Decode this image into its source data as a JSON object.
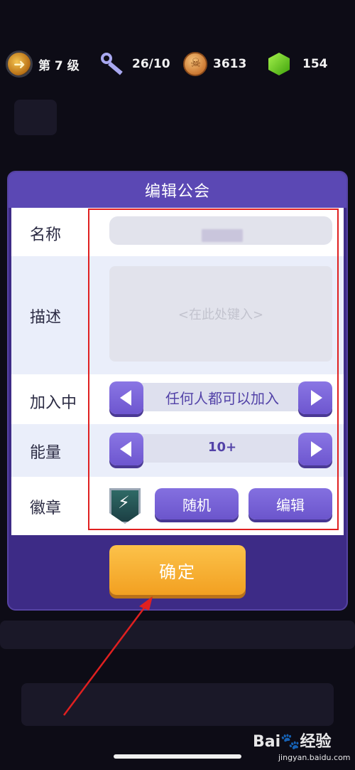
{
  "status_bar": {
    "level": "第 7 级",
    "keys": "26/10",
    "coins": "3613",
    "gems": "154",
    "icons": [
      "level-badge-icon",
      "key-icon",
      "skull-coin-icon",
      "green-gem-icon"
    ]
  },
  "dialog": {
    "title": "编辑公会",
    "name_label": "名称",
    "description_label": "描述",
    "description_placeholder": "<在此处键入>",
    "join_label": "加入中",
    "join_value": "任何人都可以加入",
    "energy_label": "能量",
    "energy_value": "10+",
    "badge_label": "徽章",
    "random_button": "随机",
    "edit_button": "编辑",
    "confirm_button": "确定"
  },
  "watermark": {
    "logo": "Bai🐾经验",
    "url": "jingyan.baidu.com"
  },
  "colors": {
    "dialog_bg": "#3d2b86",
    "header_bg": "#5b48b4",
    "button_purple": "#7a64d8",
    "confirm_orange": "#f6ac2e",
    "highlight_red": "#e02020"
  }
}
